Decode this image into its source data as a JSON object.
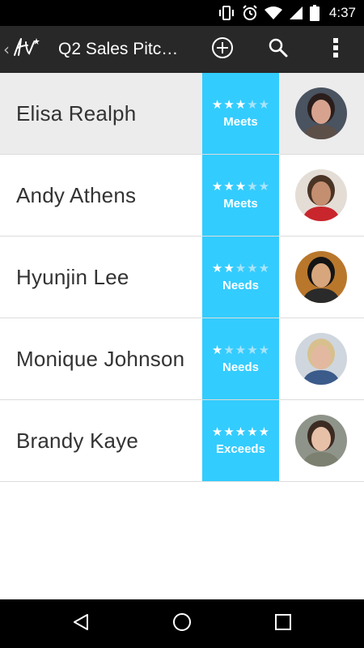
{
  "status_bar": {
    "time": "4:37",
    "icons": [
      "vibrate-icon",
      "alarm-icon",
      "wifi-icon",
      "signal-icon",
      "battery-icon"
    ]
  },
  "action_bar": {
    "title": "Q2 Sales Pitc…",
    "back_icon": "chevron-left-icon",
    "logo_icon": "hv-logo-icon",
    "actions": [
      "add-circle-icon",
      "search-icon",
      "overflow-menu-icon"
    ]
  },
  "list": {
    "rows": [
      {
        "name": "Elisa Realph",
        "stars": 3,
        "max_stars": 5,
        "rating": "Meets",
        "selected": true,
        "avatar_colors": {
          "bg": "#4a5360",
          "hair": "#2a1e1c",
          "skin": "#d7a38f",
          "shirt": "#5c4f48"
        }
      },
      {
        "name": "Andy Athens",
        "stars": 3,
        "max_stars": 5,
        "rating": "Meets",
        "selected": false,
        "avatar_colors": {
          "bg": "#e4ddd6",
          "hair": "#4a3425",
          "skin": "#c48f70",
          "shirt": "#c8262c"
        }
      },
      {
        "name": "Hyunjin Lee",
        "stars": 2,
        "max_stars": 5,
        "rating": "Needs",
        "selected": false,
        "avatar_colors": {
          "bg": "#b9772c",
          "hair": "#141414",
          "skin": "#d8a67c",
          "shirt": "#2a2a2a"
        }
      },
      {
        "name": "Monique Johnson",
        "stars": 1,
        "max_stars": 5,
        "rating": "Needs",
        "selected": false,
        "avatar_colors": {
          "bg": "#cfd6de",
          "hair": "#d8c08e",
          "skin": "#e2b9a0",
          "shirt": "#3b5b8a"
        }
      },
      {
        "name": "Brandy Kaye",
        "stars": 5,
        "max_stars": 5,
        "rating": "Exceeds",
        "selected": false,
        "avatar_colors": {
          "bg": "#8f948a",
          "hair": "#3b2b22",
          "skin": "#e7c0a8",
          "shirt": "#7c8070"
        }
      }
    ]
  },
  "nav_bar": {
    "buttons": [
      "back-triangle-icon",
      "home-circle-icon",
      "recents-square-icon"
    ]
  },
  "colors": {
    "rating_accent": "#33ccff",
    "action_bar": "#282828",
    "selected_row": "#ececec"
  }
}
